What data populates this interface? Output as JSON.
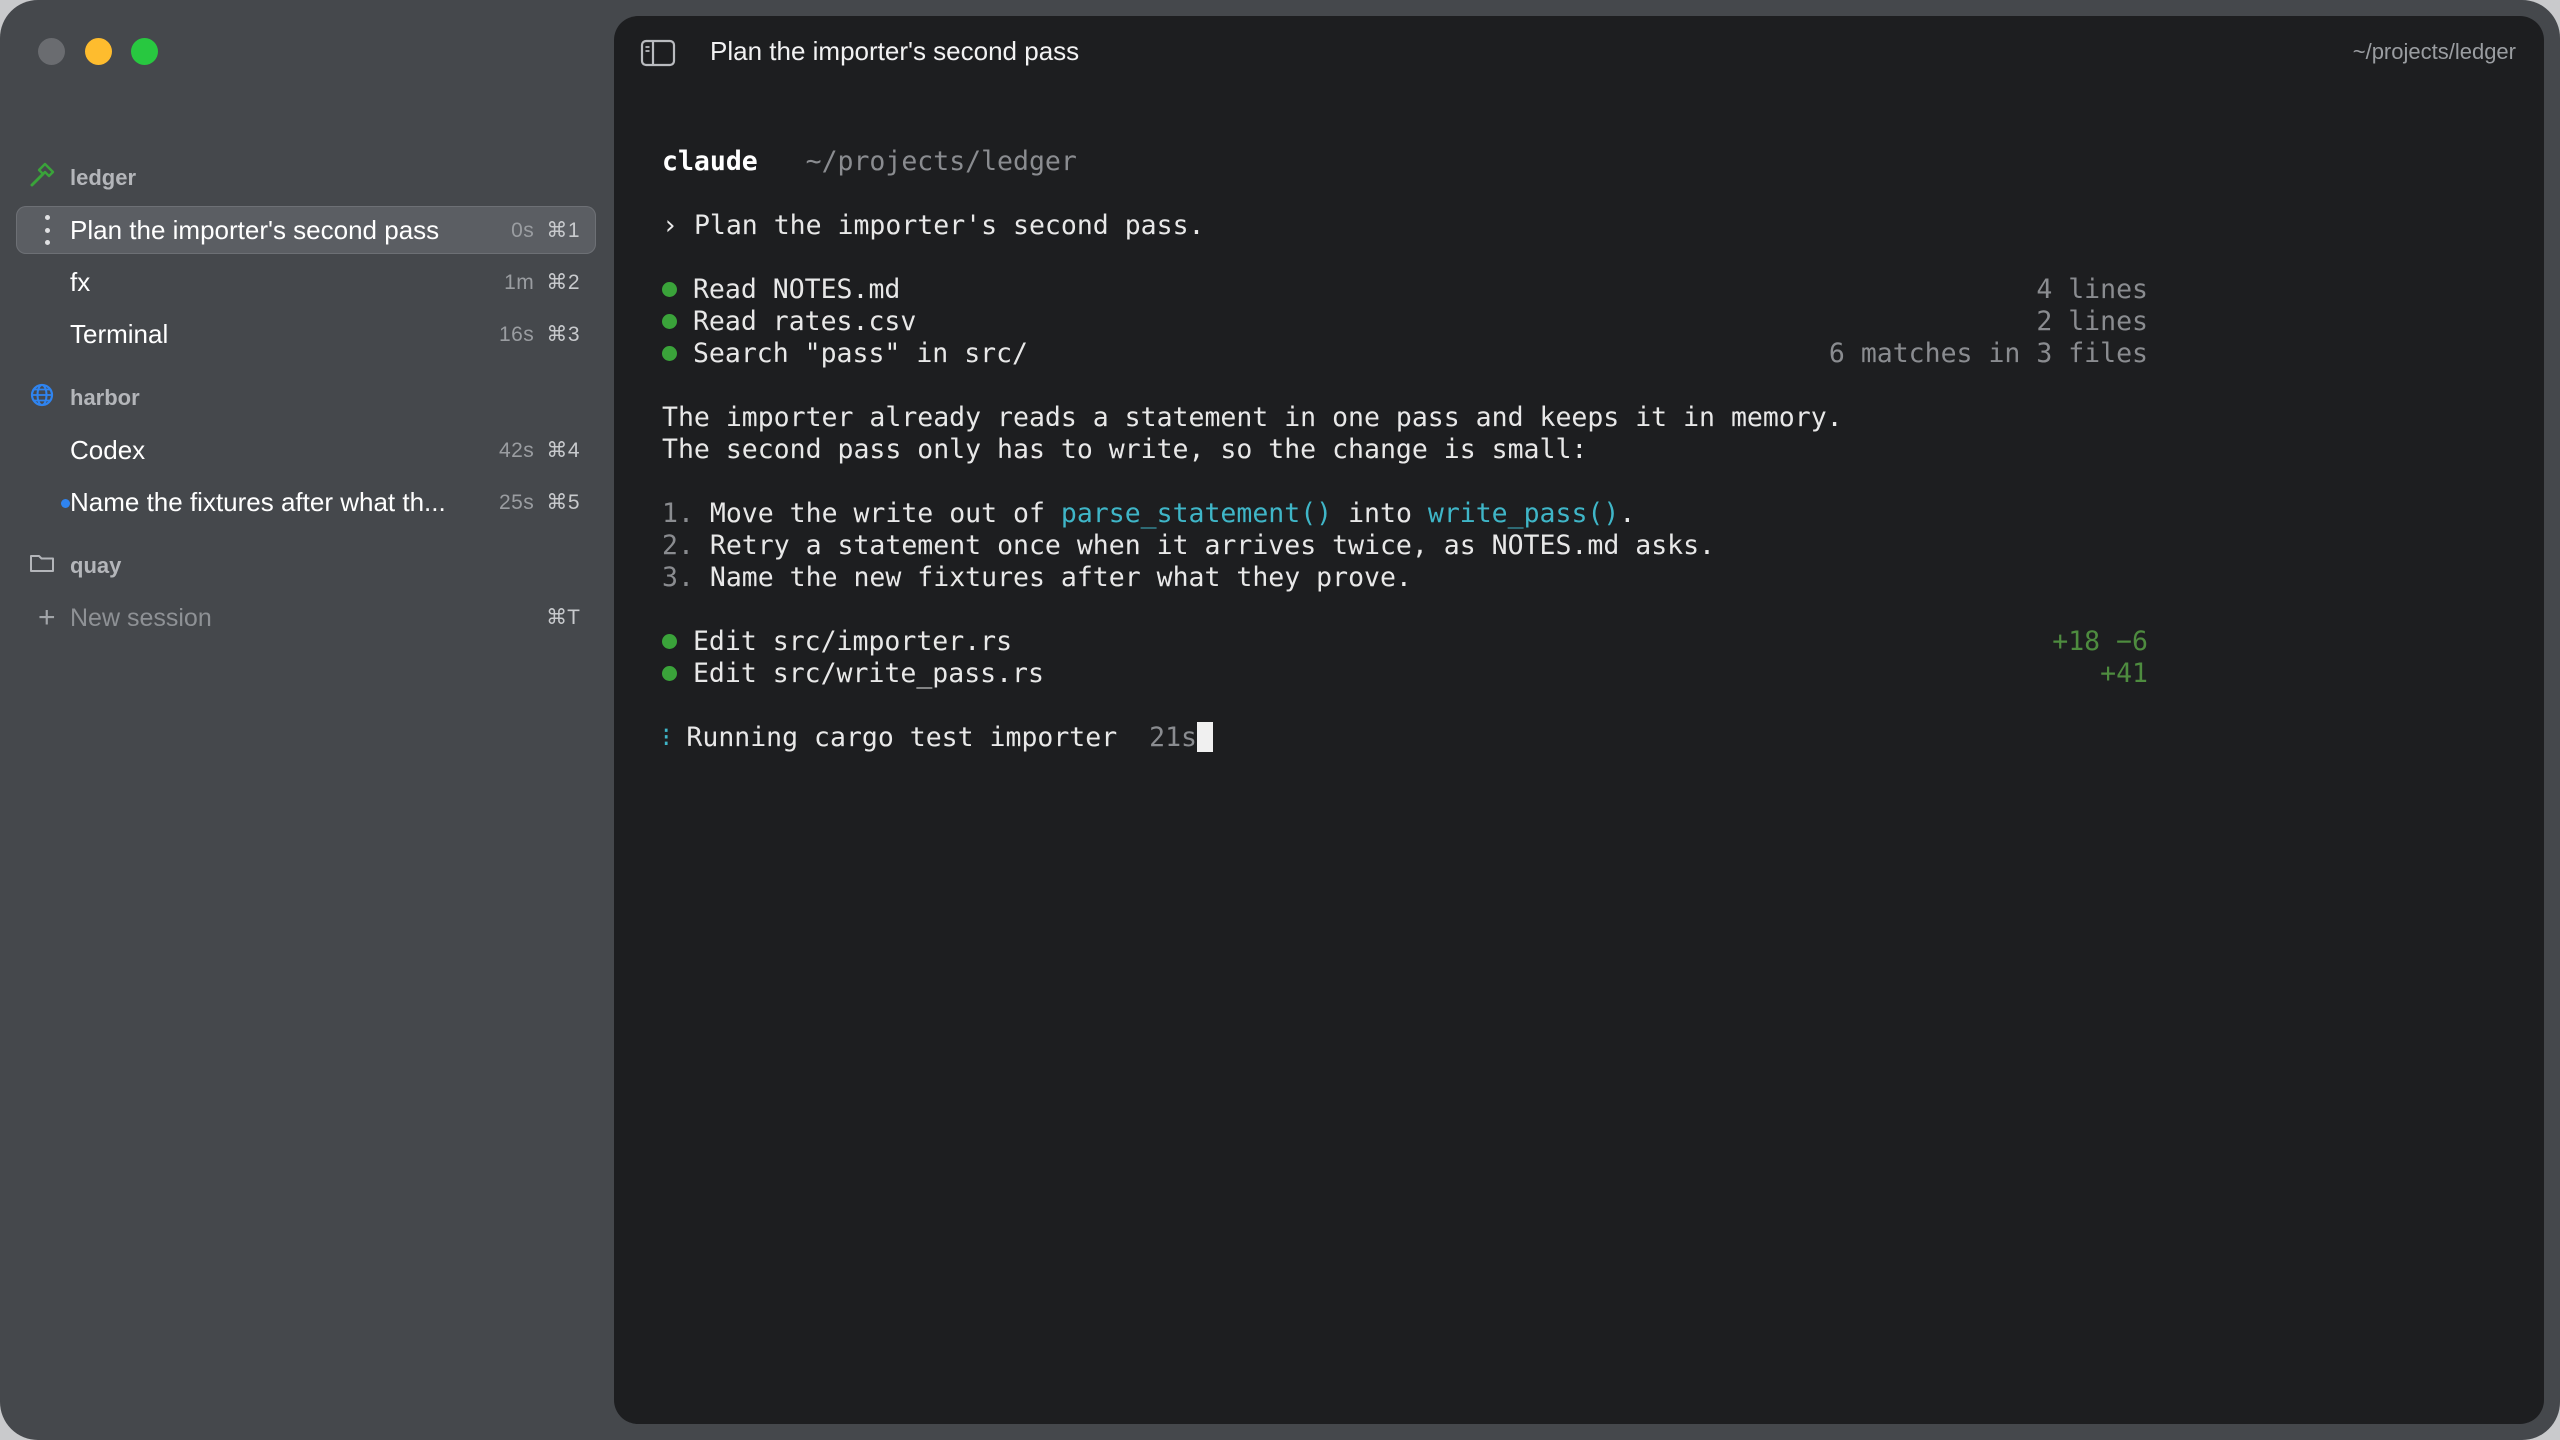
{
  "sidebar": {
    "groups": [
      {
        "name": "ledger",
        "icon": "hammer-icon",
        "sessions": [
          {
            "label": "Plan the importer's second pass",
            "time": "0s",
            "shortcut": "⌘1",
            "active": true
          },
          {
            "label": "fx",
            "time": "1m",
            "shortcut": "⌘2"
          },
          {
            "label": "Terminal",
            "time": "16s",
            "shortcut": "⌘3"
          }
        ]
      },
      {
        "name": "harbor",
        "icon": "globe-icon",
        "sessions": [
          {
            "label": "Codex",
            "time": "42s",
            "shortcut": "⌘4"
          },
          {
            "label": "Name the fixtures after what th...",
            "time": "25s",
            "shortcut": "⌘5",
            "unread": true
          }
        ]
      },
      {
        "name": "quay",
        "icon": "folder-icon",
        "sessions": []
      }
    ],
    "new_session": {
      "label": "New session",
      "shortcut": "⌘T"
    }
  },
  "panel": {
    "title": "Plan the importer's second pass",
    "path": "~/projects/ledger"
  },
  "terminal": {
    "header_app": "claude",
    "header_path": "~/projects/ledger",
    "prompt_marker": "›",
    "prompt_text": "Plan the importer's second pass.",
    "tool_calls": [
      {
        "text": "Read NOTES.md",
        "result": "4 lines"
      },
      {
        "text": "Read rates.csv",
        "result": "2 lines"
      },
      {
        "text": "Search \"pass\" in src/",
        "result": "6 matches in 3 files"
      }
    ],
    "paragraph": [
      "The importer already reads a statement in one pass and keeps it in memory.",
      "The second pass only has to write, so the change is small:"
    ],
    "steps": [
      {
        "num": "1.",
        "pre": "Move the write out of ",
        "code1": "parse_statement()",
        "mid": " into ",
        "code2": "write_pass()",
        "post": "."
      },
      {
        "num": "2.",
        "text": "Retry a statement once when it arrives twice, as NOTES.md asks."
      },
      {
        "num": "3.",
        "text": "Name the new fixtures after what they prove."
      }
    ],
    "edits": [
      {
        "text": "Edit src/importer.rs",
        "diff": "+18 −6"
      },
      {
        "text": "Edit src/write_pass.rs",
        "diff": "+41"
      }
    ],
    "running": {
      "marker": "⁝",
      "text": "Running cargo test importer",
      "elapsed": "21s"
    }
  },
  "colors": {
    "window_bg": "#45484c",
    "panel_bg": "#1d1e20",
    "status_green": "#3aa33a",
    "code_cyan": "#3fb6c8",
    "diff_green": "#4e8c3f",
    "unread_blue": "#2f84f0"
  }
}
